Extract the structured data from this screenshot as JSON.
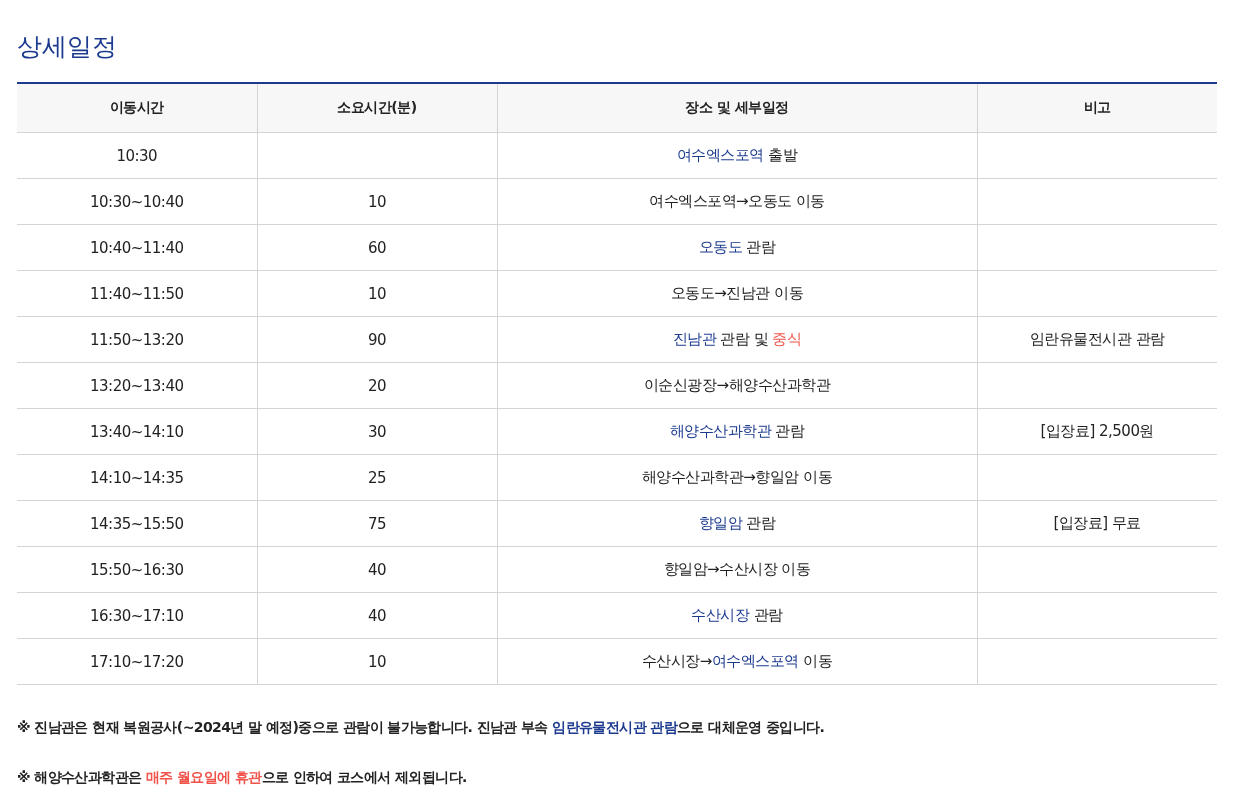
{
  "title": "상세일정",
  "table": {
    "columns": [
      "이동시간",
      "소요시간(분)",
      "장소 및 세부일정",
      "비고"
    ],
    "rows": [
      {
        "time": "10:30",
        "minutes": "",
        "place": [
          {
            "kind": "place",
            "text": "여수엑스포역"
          },
          {
            "kind": "plain",
            "text": " 출발"
          }
        ],
        "note": ""
      },
      {
        "time": "10:30~10:40",
        "minutes": "10",
        "place": [
          {
            "kind": "plain",
            "text": "여수엑스포역→오동도 이동"
          }
        ],
        "note": ""
      },
      {
        "time": "10:40~11:40",
        "minutes": "60",
        "place": [
          {
            "kind": "place",
            "text": "오동도"
          },
          {
            "kind": "plain",
            "text": " 관람"
          }
        ],
        "note": ""
      },
      {
        "time": "11:40~11:50",
        "minutes": "10",
        "place": [
          {
            "kind": "plain",
            "text": "오동도→진남관 이동"
          }
        ],
        "note": ""
      },
      {
        "time": "11:50~13:20",
        "minutes": "90",
        "place": [
          {
            "kind": "place",
            "text": "진남관"
          },
          {
            "kind": "plain",
            "text": " 관람 및 "
          },
          {
            "kind": "alert",
            "text": "중식"
          }
        ],
        "note": "임란유물전시관 관람"
      },
      {
        "time": "13:20~13:40",
        "minutes": "20",
        "place": [
          {
            "kind": "plain",
            "text": "이순신광장→해양수산과학관"
          }
        ],
        "note": ""
      },
      {
        "time": "13:40~14:10",
        "minutes": "30",
        "place": [
          {
            "kind": "place",
            "text": "해양수산과학관"
          },
          {
            "kind": "plain",
            "text": " 관람"
          }
        ],
        "note": "[입장료] 2,500원"
      },
      {
        "time": "14:10~14:35",
        "minutes": "25",
        "place": [
          {
            "kind": "plain",
            "text": "해양수산과학관→향일암 이동"
          }
        ],
        "note": ""
      },
      {
        "time": "14:35~15:50",
        "minutes": "75",
        "place": [
          {
            "kind": "place",
            "text": "향일암"
          },
          {
            "kind": "plain",
            "text": " 관람"
          }
        ],
        "note": "[입장료] 무료"
      },
      {
        "time": "15:50~16:30",
        "minutes": "40",
        "place": [
          {
            "kind": "plain",
            "text": "향일암→수산시장 이동"
          }
        ],
        "note": ""
      },
      {
        "time": "16:30~17:10",
        "minutes": "40",
        "place": [
          {
            "kind": "place",
            "text": "수산시장"
          },
          {
            "kind": "plain",
            "text": " 관람"
          }
        ],
        "note": ""
      },
      {
        "time": "17:10~17:20",
        "minutes": "10",
        "place": [
          {
            "kind": "plain",
            "text": "수산시장→"
          },
          {
            "kind": "place",
            "text": "여수엑스포역"
          },
          {
            "kind": "plain",
            "text": " 이동"
          }
        ],
        "note": ""
      }
    ]
  },
  "notes": [
    [
      {
        "kind": "plain",
        "text": "※ 진남관은 현재 복원공사(~2024년 말 예정)중으로 관람이 불가능합니다. 진남관 부속 "
      },
      {
        "kind": "place",
        "text": "임란유물전시관 관람"
      },
      {
        "kind": "plain",
        "text": "으로 대체운영 중입니다."
      }
    ],
    [
      {
        "kind": "plain",
        "text": "※ 해양수산과학관은 "
      },
      {
        "kind": "alert",
        "text": "매주 월요일에 휴관"
      },
      {
        "kind": "plain",
        "text": "으로 인하여 코스에서 제외됩니다."
      }
    ]
  ]
}
